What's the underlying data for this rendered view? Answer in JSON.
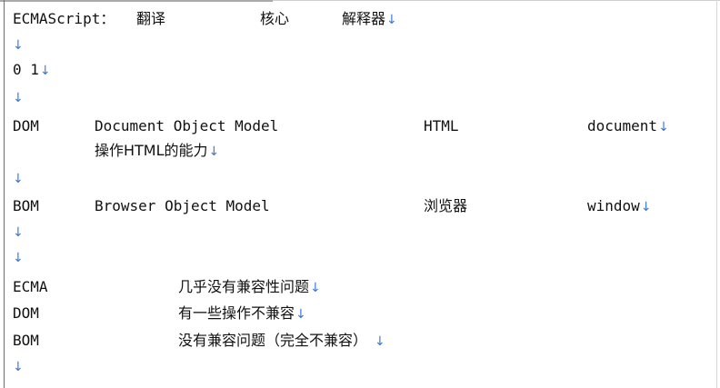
{
  "return_mark": "↓",
  "lines": {
    "l1": {
      "label": "ECMAScript：",
      "a": "翻译",
      "b": "核心",
      "c": "解释器"
    },
    "l3": {
      "text": "0 1"
    },
    "dom": {
      "label": "DOM",
      "full": "Document Object Model",
      "html": "HTML",
      "obj": "document",
      "desc": "操作HTML的能力"
    },
    "bom": {
      "label": "BOM",
      "full": "Browser Object Model",
      "browser": "浏览器",
      "obj": "window"
    },
    "compat": {
      "ecma": {
        "label": "ECMA",
        "desc": "几乎没有兼容性问题"
      },
      "dom": {
        "label": "DOM",
        "desc": "有一些操作不兼容"
      },
      "bom": {
        "label": "BOM",
        "desc": "没有兼容问题（完全不兼容）"
      }
    }
  }
}
